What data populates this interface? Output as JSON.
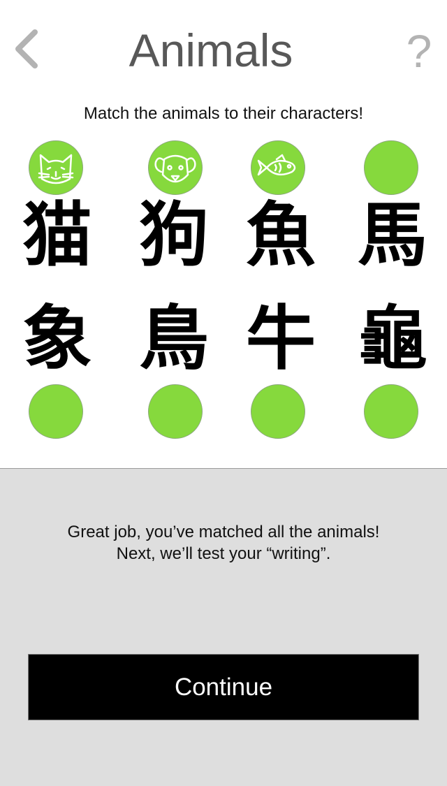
{
  "header": {
    "title": "Animals",
    "back_icon": "chevron-left-icon",
    "help_label": "?"
  },
  "instruction": "Match the animals to their characters!",
  "colors": {
    "accent_green": "#86d93d",
    "title_gray": "#585858",
    "help_gray": "#b3b3b3",
    "panel_bg": "#dedede",
    "button_bg": "#000000"
  },
  "top_row": {
    "animals": [
      {
        "icon": "cat-icon",
        "kanji": "猫"
      },
      {
        "icon": "dog-icon",
        "kanji": "狗"
      },
      {
        "icon": "fish-icon",
        "kanji": "魚"
      },
      {
        "icon": "",
        "kanji": "馬"
      }
    ]
  },
  "bottom_row": {
    "animals": [
      {
        "icon": "",
        "kanji": "象"
      },
      {
        "icon": "",
        "kanji": "鳥"
      },
      {
        "icon": "",
        "kanji": "牛"
      },
      {
        "icon": "",
        "kanji": "龜"
      }
    ]
  },
  "result_panel": {
    "line1": "Great job, you’ve matched all the animals!",
    "line2": "Next, we’ll test your “writing”.",
    "continue_label": "Continue"
  }
}
